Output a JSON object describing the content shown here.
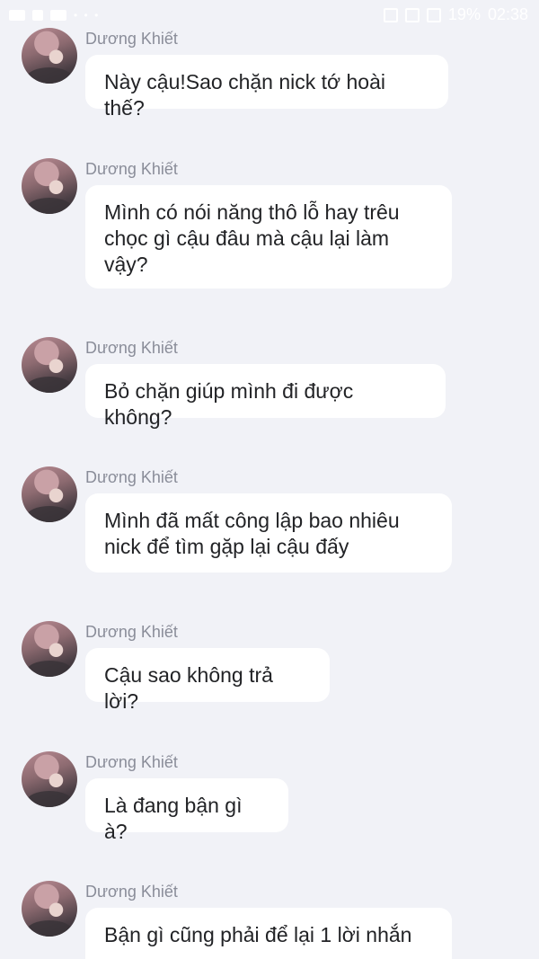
{
  "status_bar": {
    "battery": "19%",
    "time": "02:38",
    "dots": "• • •"
  },
  "messages": [
    {
      "sender": "Dương Khiết",
      "text": "Này cậu!Sao chặn nick tớ hoài thế?"
    },
    {
      "sender": "Dương Khiết",
      "text": "Mình có nói năng thô lỗ hay trêu chọc gì cậu đâu mà cậu lại làm vậy?"
    },
    {
      "sender": "Dương Khiết",
      "text": "Bỏ chặn giúp mình đi được không?"
    },
    {
      "sender": "Dương Khiết",
      "text": "Mình đã mất công lập bao nhiêu nick để tìm gặp lại cậu đấy"
    },
    {
      "sender": "Dương Khiết",
      "text": "Cậu sao không trả lời?"
    },
    {
      "sender": "Dương Khiết",
      "text": "Là đang bận gì à?"
    },
    {
      "sender": "Dương Khiết",
      "text": "Bận gì cũng phải để lại 1 lời nhắn"
    }
  ]
}
